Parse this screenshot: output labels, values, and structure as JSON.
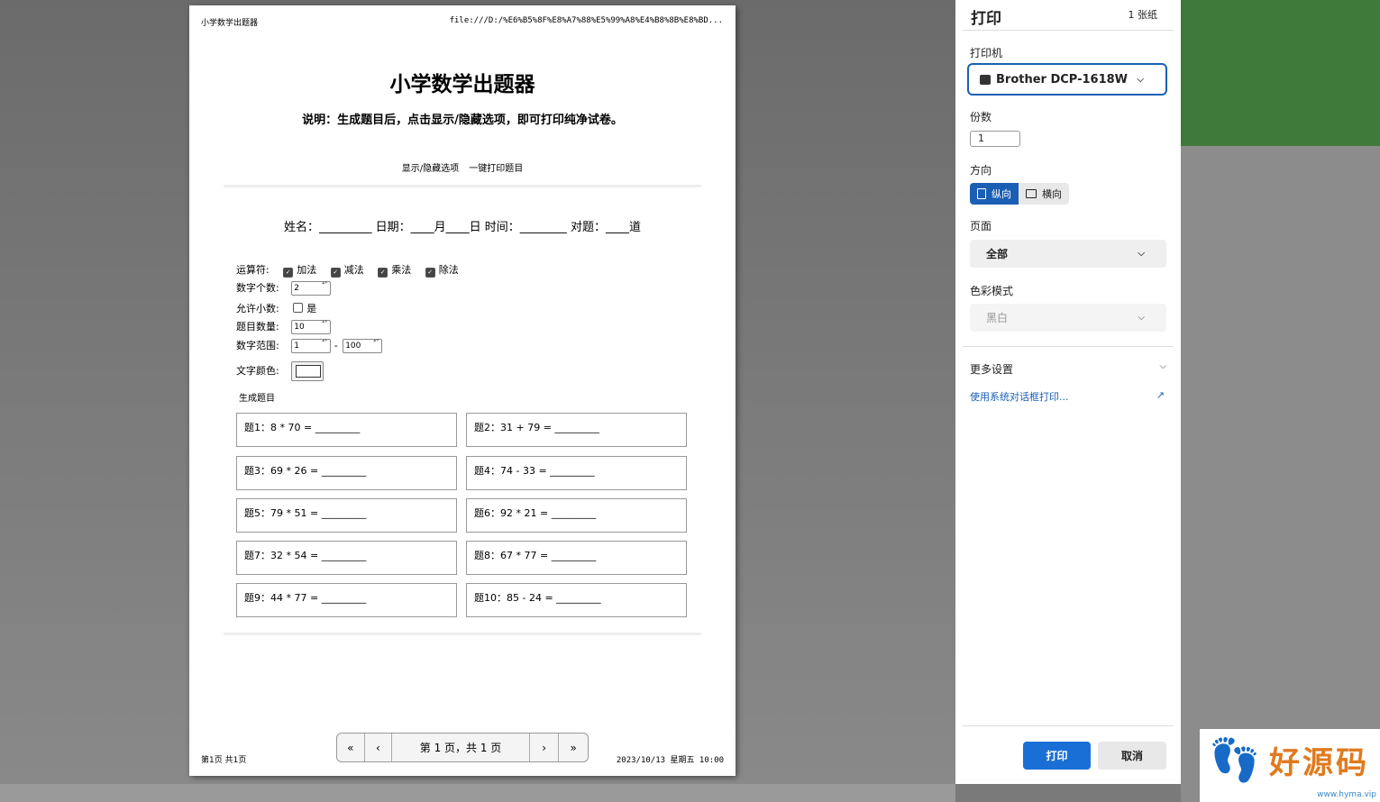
{
  "doc": {
    "header_left": "小学数学出题器",
    "header_right": "file:///D:/%E6%B5%8F%E8%A7%88%E5%99%A8%E4%B8%8B%E8%BD...",
    "footer_left": "第1页 共1页",
    "footer_right": "2023/10/13 星期五 10:00",
    "title": "小学数学出题器",
    "desc": "说明：生成题目后，点击显示/隐藏选项，即可打印纯净试卷。",
    "btn_toggle": "显示/隐藏选项",
    "btn_print": "一键打印题目",
    "student_line": "姓名：_________ 日期：____月____日 时间：________ 对题：____道",
    "form": {
      "ops_label": "运算符:",
      "ops": [
        {
          "label": "加法",
          "checked": true
        },
        {
          "label": "减法",
          "checked": true
        },
        {
          "label": "乘法",
          "checked": true
        },
        {
          "label": "除法",
          "checked": true
        }
      ],
      "count_label": "数字个数:",
      "count_value": "2",
      "decimal_label": "允许小数:",
      "decimal_option": "是",
      "qty_label": "题目数量:",
      "qty_value": "10",
      "range_label": "数字范围:",
      "range_min": "1",
      "range_sep": "-",
      "range_max": "100",
      "color_label": "文字颜色:",
      "generate_label": "生成题目"
    },
    "questions": [
      "题1：8 * 70 = _________",
      "题2：31 + 79 = _________",
      "题3：69 * 26 = _________",
      "题4：74 - 33 = _________",
      "题5：79 * 51 = _________",
      "题6：92 * 21 = _________",
      "题7：32 * 54 = _________",
      "题8：67 * 77 = _________",
      "题9：44 * 77 = _________",
      "题10：85 - 24 = _________"
    ]
  },
  "pager": {
    "first": "«",
    "prev": "‹",
    "label": "第 1 页，共 1 页",
    "next": "›",
    "last": "»"
  },
  "panel": {
    "title": "打印",
    "sheets": "1 张纸",
    "printer_label": "打印机",
    "printer_value": "Brother DCP-1618W",
    "copies_label": "份数",
    "copies_value": "1",
    "orientation_label": "方向",
    "portrait": "纵向",
    "landscape": "横向",
    "pages_label": "页面",
    "pages_value": "全部",
    "color_label": "色彩模式",
    "color_value": "黑白",
    "more_settings": "更多设置",
    "system_dialog": "使用系统对话框打印...",
    "print_button": "打印",
    "cancel_button": "取消"
  },
  "watermark": {
    "text": "好源码",
    "url": "www.hyma.vip"
  }
}
